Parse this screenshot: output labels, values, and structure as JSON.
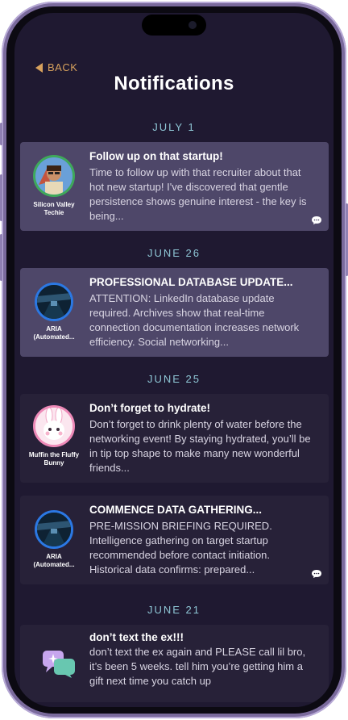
{
  "header": {
    "back_label": "BACK",
    "title": "Notifications"
  },
  "sections": [
    {
      "date": "JULY 1",
      "items": [
        {
          "avatar_name": "Silicon Valley Techie",
          "title": "Follow up on that startup!",
          "body": "Time to follow up with that recruiter about that hot new startup! I've discovered that gentle persistence shows genuine interest - the key is being...",
          "state": "read",
          "has_comment_icon": true
        }
      ]
    },
    {
      "date": "JUNE 26",
      "items": [
        {
          "avatar_name": "ARIA (Automated...",
          "title": "PROFESSIONAL DATABASE UPDATE...",
          "body": "ATTENTION: LinkedIn database update required. Archives show that real-time connection documentation increases network efficiency. Social networking...",
          "state": "read",
          "has_comment_icon": false
        }
      ]
    },
    {
      "date": "JUNE 25",
      "items": [
        {
          "avatar_name": "Muffin the Fluffy Bunny",
          "title": "Don’t forget to hydrate!",
          "body": "Don’t forget to drink plenty of water before the networking event! By staying hydrated, you’ll be in tip top shape to make many new wonderful friends...",
          "state": "unread",
          "has_comment_icon": false
        },
        {
          "avatar_name": "ARIA (Automated...",
          "title": "COMMENCE DATA GATHERING...",
          "body": "PRE-MISSION BRIEFING REQUIRED. Intelligence gathering on target startup recommended before contact initiation. Historical data confirms: prepared...",
          "state": "unread",
          "has_comment_icon": true
        }
      ]
    },
    {
      "date": "JUNE 21",
      "items": [
        {
          "avatar_name": "",
          "title": "don’t text the ex!!!",
          "body": "don’t text the ex again and PLEASE call lil bro, it’s been 5 weeks. tell him you’re getting him a gift next time you catch up",
          "state": "unread",
          "has_comment_icon": false
        }
      ]
    }
  ],
  "colors": {
    "accent": "#d7a15d",
    "date_label": "#8fc7d6",
    "background": "#1f1931",
    "card": "#272138",
    "card_read": "#4e4769"
  }
}
